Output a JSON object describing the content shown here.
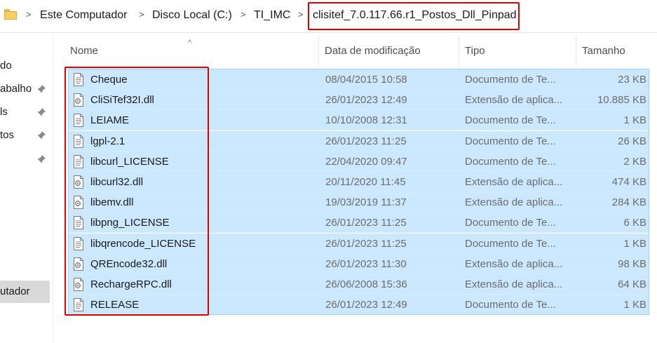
{
  "breadcrumb": {
    "items": [
      "Este Computador",
      "Disco Local (C:)",
      "TI_IMC",
      "clisitef_7.0.117.66.r1_Postos_Dll_Pinpad"
    ],
    "separator": ">"
  },
  "sidebar": {
    "items": [
      {
        "label": "do",
        "pinned": false
      },
      {
        "label": "abalho",
        "pinned": true
      },
      {
        "label": "ls",
        "pinned": true
      },
      {
        "label": "tos",
        "pinned": true
      },
      {
        "label": "",
        "pinned": true
      },
      {
        "label": "utador",
        "pinned": false,
        "selected": true
      }
    ]
  },
  "columns": {
    "name": "Nome",
    "date": "Data de modificação",
    "type": "Tipo",
    "size": "Tamanho",
    "sort_indicator": "^"
  },
  "files": [
    {
      "name": "Cheque",
      "date": "08/04/2015 10:58",
      "type": "Documento de Te...",
      "size": "23 KB",
      "icon": "text-document-icon"
    },
    {
      "name": "CliSiTef32I.dll",
      "date": "26/01/2023 12:49",
      "type": "Extensão de aplica...",
      "size": "10.885 KB",
      "icon": "dll-file-icon"
    },
    {
      "name": "LEIAME",
      "date": "10/10/2008 12:31",
      "type": "Documento de Te...",
      "size": "1 KB",
      "icon": "text-document-icon"
    },
    {
      "name": "lgpl-2.1",
      "date": "26/01/2023 11:25",
      "type": "Documento de Te...",
      "size": "26 KB",
      "icon": "text-document-icon"
    },
    {
      "name": "libcurl_LICENSE",
      "date": "22/04/2020 09:47",
      "type": "Documento de Te...",
      "size": "2 KB",
      "icon": "text-document-icon"
    },
    {
      "name": "libcurl32.dll",
      "date": "20/11/2020 11:45",
      "type": "Extensão de aplica...",
      "size": "474 KB",
      "icon": "dll-file-icon"
    },
    {
      "name": "libemv.dll",
      "date": "19/03/2019 11:37",
      "type": "Extensão de aplica...",
      "size": "284 KB",
      "icon": "dll-file-icon"
    },
    {
      "name": "libpng_LICENSE",
      "date": "26/01/2023 11:25",
      "type": "Documento de Te...",
      "size": "6 KB",
      "icon": "text-document-icon"
    },
    {
      "name": "libqrencode_LICENSE",
      "date": "26/01/2023 11:25",
      "type": "Documento de Te...",
      "size": "1 KB",
      "icon": "text-document-icon"
    },
    {
      "name": "QREncode32.dll",
      "date": "26/01/2023 11:30",
      "type": "Extensão de aplica...",
      "size": "98 KB",
      "icon": "dll-file-icon"
    },
    {
      "name": "RechargeRPC.dll",
      "date": "26/06/2008 15:36",
      "type": "Extensão de aplica...",
      "size": "64 KB",
      "icon": "dll-file-icon"
    },
    {
      "name": "RELEASE",
      "date": "26/01/2023 12:49",
      "type": "Documento de Te...",
      "size": "1 KB",
      "icon": "text-document-icon"
    }
  ],
  "colors": {
    "selection_bg": "#cce8ff",
    "annotation_red": "#e00000",
    "folder_yellow": "#f4cf62"
  }
}
